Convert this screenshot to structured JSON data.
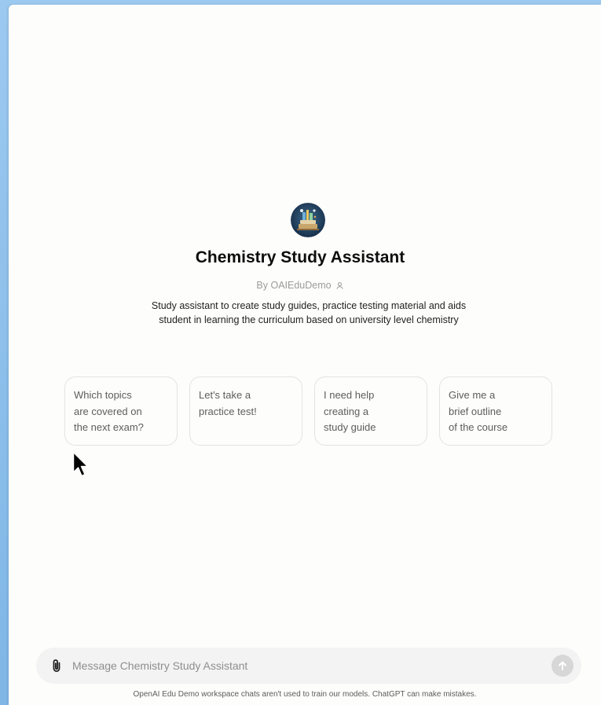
{
  "gpt": {
    "name": "Chemistry Study Assistant",
    "byline": "By OAIEduDemo",
    "description": "Study assistant to create study guides, practice testing material and aids student in learning the curriculum based on university level chemistry"
  },
  "suggestions": [
    {
      "text": "Which topics\nare covered on\nthe next exam?"
    },
    {
      "text": "Let's take a\npractice test!"
    },
    {
      "text": "I need help\ncreating a\nstudy guide"
    },
    {
      "text": "Give me a\nbrief outline\nof the course"
    }
  ],
  "composer": {
    "placeholder": "Message Chemistry Study Assistant"
  },
  "footer": {
    "disclaimer": "OpenAI Edu Demo workspace chats aren't used to train our models. ChatGPT can make mistakes."
  },
  "icons": {
    "attach": "paperclip-icon",
    "send": "arrow-up-icon",
    "byline": "person-icon"
  },
  "colors": {
    "background": "#fdfdfc",
    "composer_bg": "#f3f3f3",
    "send_disabled": "#d7d7d7",
    "card_border": "#e3e3e3"
  }
}
